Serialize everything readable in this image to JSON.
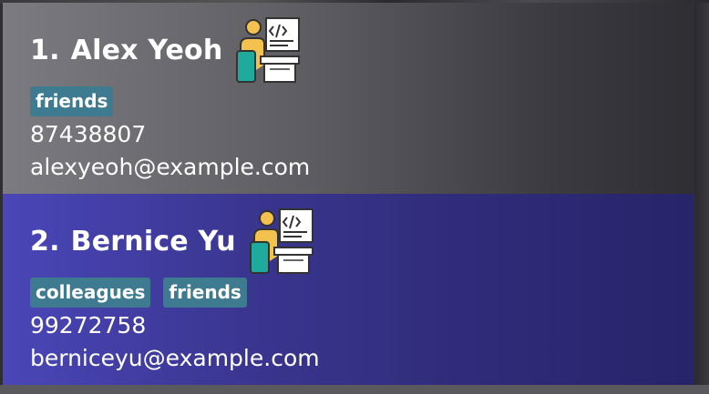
{
  "persons": [
    {
      "index": "1.",
      "name": "Alex Yeoh",
      "tags": [
        "friends"
      ],
      "phone": "87438807",
      "email": "alexyeoh@example.com"
    },
    {
      "index": "2.",
      "name": "Bernice Yu",
      "tags": [
        "colleagues",
        "friends"
      ],
      "phone": "99272758",
      "email": "berniceyu@example.com"
    }
  ],
  "avatar_icon": "developer-at-computer-icon",
  "colors": {
    "selected_card": "#3a3690",
    "card": "#5c5c61",
    "tag": "#3e7b91",
    "avatar_yellow": "#f2c14e",
    "avatar_teal": "#1faa9e"
  }
}
